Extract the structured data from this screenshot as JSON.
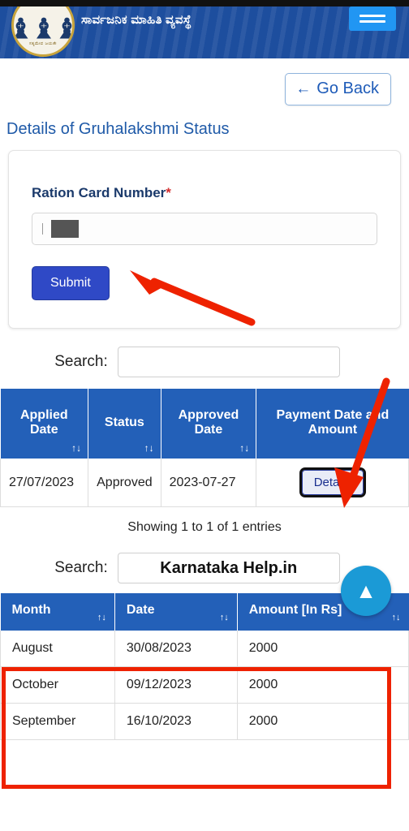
{
  "header": {
    "title": "ಸಾರ್ವಜನಿಕ ಮಾಹಿತಿ ವ್ಯವಸ್ಥೆ",
    "emblem_text": "ಸತ್ಯಮೇವ ಜಯತೇ",
    "menu_icon": "hamburger-icon",
    "logo_icon": "karnataka-emblem-icon"
  },
  "toolbar": {
    "go_back_label": "Go Back",
    "go_back_icon": "arrow-left-icon"
  },
  "page": {
    "title": "Details of Gruhalakshmi Status"
  },
  "form": {
    "ration_card_label": "Ration Card Number",
    "required_marker": "*",
    "ration_card_value": "",
    "ration_card_placeholder": "",
    "submit_label": "Submit"
  },
  "table1": {
    "search_label": "Search:",
    "search_value": "",
    "columns": [
      {
        "label": "Applied Date",
        "sort": "↑↓"
      },
      {
        "label": "Status",
        "sort": "↑↓"
      },
      {
        "label": "Approved Date",
        "sort": "↑↓"
      },
      {
        "label": "Payment Date and Amount",
        "sort": ""
      }
    ],
    "rows": [
      {
        "applied_date": "27/07/2023",
        "status": "Approved",
        "approved_date": "2023-07-27",
        "action_label": "Details"
      }
    ]
  },
  "table2": {
    "showing_text": "Showing 1 to 1 of 1 entries",
    "search_label": "Search:",
    "search_value": "Karnataka Help.in",
    "columns": [
      {
        "label": "Month",
        "sort": "↑↓"
      },
      {
        "label": "Date",
        "sort": "↑↓"
      },
      {
        "label": "Amount [In Rs]",
        "sort": "↑↓"
      }
    ],
    "rows": [
      {
        "month": "August",
        "date": "30/08/2023",
        "amount": "2000"
      },
      {
        "month": "October",
        "date": "09/12/2023",
        "amount": "2000"
      },
      {
        "month": "September",
        "date": "16/10/2023",
        "amount": "2000"
      }
    ]
  },
  "fab": {
    "icon": "chevron-up-icon"
  },
  "colors": {
    "header_blue": "#1d4e9e",
    "table_header_blue": "#2360b8",
    "submit_blue": "#2f49c6",
    "annotation_red": "#ee2200",
    "fab_blue": "#1b9ad6"
  }
}
